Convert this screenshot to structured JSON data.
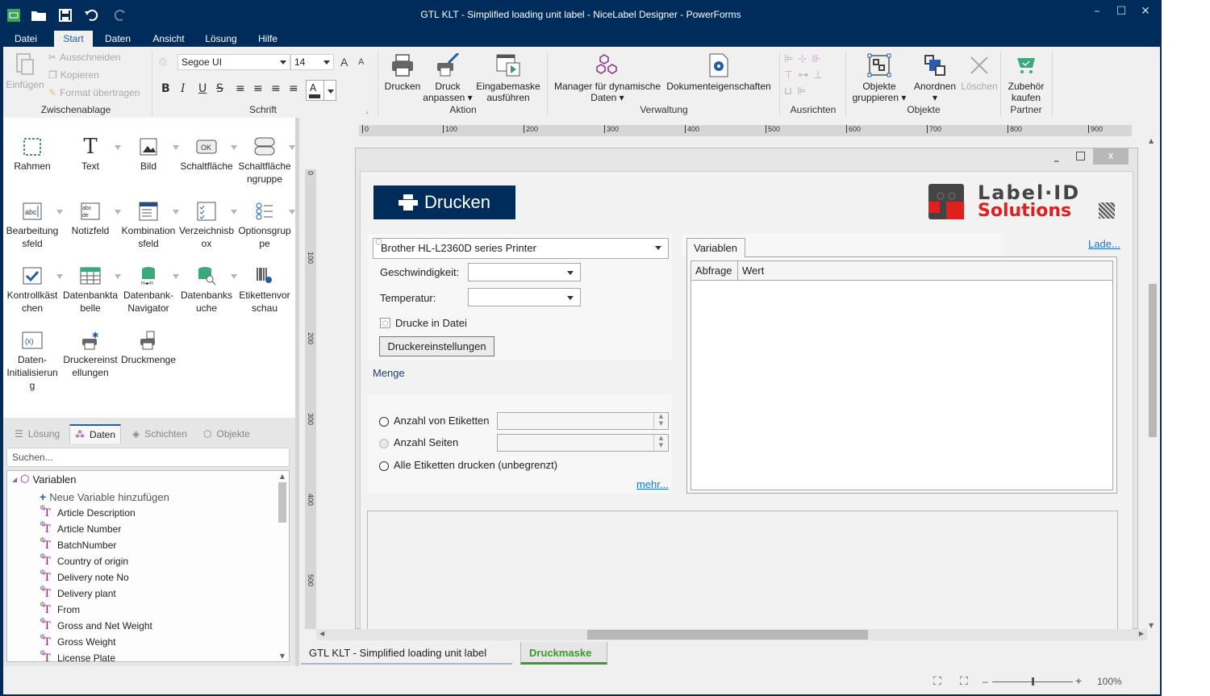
{
  "window": {
    "title": "GTL KLT - Simplified loading unit label - NiceLabel Designer - PowerForms",
    "controls": {
      "minimize": "–",
      "maximize": "☐",
      "close": "✕"
    }
  },
  "quick_access": [
    "app-icon",
    "open-folder-icon",
    "save-icon",
    "undo-icon",
    "redo-icon"
  ],
  "menu": {
    "items": [
      "Datei",
      "Start",
      "Daten",
      "Ansicht",
      "Lösung",
      "Hilfe"
    ],
    "active": "Start"
  },
  "ribbon": {
    "clipboard": {
      "label": "Zwischenablage",
      "paste": "Einfügen",
      "cut": "Ausschneiden",
      "copy": "Kopieren",
      "format_painter": "Format übertragen"
    },
    "font": {
      "label": "Schrift",
      "family": "Segoe UI",
      "size": "14",
      "bold": "B",
      "italic": "I",
      "underline": "U",
      "strike": "S",
      "color_letter": "A"
    },
    "action": {
      "label": "Aktion",
      "print": "Drucken",
      "customize_print_1": "Druck",
      "customize_print_2": "anpassen",
      "run_form_1": "Eingabemaske",
      "run_form_2": "ausführen"
    },
    "management": {
      "label": "Verwaltung",
      "dynamic_data_1": "Manager für dynamische",
      "dynamic_data_2": "Daten",
      "doc_props": "Dokumenteigenschaften"
    },
    "align": {
      "label": "Ausrichten"
    },
    "objects": {
      "label": "Objekte",
      "group_1": "Objekte",
      "group_2": "gruppieren",
      "arrange": "Anordnen",
      "delete": "Löschen"
    },
    "partner": {
      "label": "Partner",
      "buy_1": "Zubehör",
      "buy_2": "kaufen"
    }
  },
  "toolbox": {
    "items": [
      {
        "l1": "Rahmen",
        "l2": "",
        "l3": "",
        "icon": "frame-icon",
        "dd": false
      },
      {
        "l1": "Text",
        "l2": "",
        "l3": "",
        "icon": "text-icon",
        "dd": true
      },
      {
        "l1": "Bild",
        "l2": "",
        "l3": "",
        "icon": "image-icon",
        "dd": true
      },
      {
        "l1": "Schaltfläche",
        "l2": "",
        "l3": "",
        "icon": "button-icon",
        "dd": true
      },
      {
        "l1": "Schaltfläche",
        "l2": "ngruppe",
        "l3": "",
        "icon": "button-group-icon",
        "dd": true
      },
      {
        "l1": "Bearbeitung",
        "l2": "sfeld",
        "l3": "",
        "icon": "edit-field-icon",
        "dd": true
      },
      {
        "l1": "Notizfeld",
        "l2": "",
        "l3": "",
        "icon": "memo-field-icon",
        "dd": true
      },
      {
        "l1": "Kombination",
        "l2": "sfeld",
        "l3": "",
        "icon": "combo-box-icon",
        "dd": true
      },
      {
        "l1": "Verzeichnisb",
        "l2": "ox",
        "l3": "",
        "icon": "list-box-icon",
        "dd": true
      },
      {
        "l1": "Optionsgrup",
        "l2": "pe",
        "l3": "",
        "icon": "radio-group-icon",
        "dd": true
      },
      {
        "l1": "Kontrollkäst",
        "l2": "chen",
        "l3": "",
        "icon": "checkbox-icon",
        "dd": true
      },
      {
        "l1": "Datenbankta",
        "l2": "belle",
        "l3": "",
        "icon": "database-table-icon",
        "dd": true
      },
      {
        "l1": "Datenbank-",
        "l2": "Navigator",
        "l3": "",
        "icon": "database-navigator-icon",
        "dd": true
      },
      {
        "l1": "Datenbanks",
        "l2": "uche",
        "l3": "",
        "icon": "database-search-icon",
        "dd": true
      },
      {
        "l1": "Etikettenvor",
        "l2": "schau",
        "l3": "",
        "icon": "label-preview-icon",
        "dd": false
      },
      {
        "l1": "Daten-",
        "l2": "Initialisierun",
        "l3": "g",
        "icon": "data-init-icon",
        "dd": false
      },
      {
        "l1": "Druckereinst",
        "l2": "ellungen",
        "l3": "",
        "icon": "printer-settings-icon",
        "dd": false
      },
      {
        "l1": "Druckmenge",
        "l2": "",
        "l3": "",
        "icon": "print-quantity-icon",
        "dd": false
      }
    ]
  },
  "panel_tabs": {
    "items": [
      "Lösung",
      "Daten",
      "Schichten",
      "Objekte"
    ],
    "active": "Daten"
  },
  "data_panel": {
    "search_placeholder": "Suchen...",
    "root": "Variablen",
    "add_new": "Neue Variable hinzufügen",
    "variables": [
      "Article Description",
      "Article Number",
      "BatchNumber",
      "Country of origin",
      "Delivery note No",
      "Delivery plant",
      "From",
      "Gross and Net Weight",
      "Gross Weight",
      "License Plate"
    ]
  },
  "ruler": {
    "h_ticks": [
      "0",
      "100",
      "200",
      "300",
      "400",
      "500",
      "600",
      "700",
      "800",
      "900"
    ],
    "v_ticks": [
      "0",
      "100",
      "200",
      "300",
      "400",
      "500"
    ]
  },
  "form": {
    "window_controls": {
      "minimize": "_",
      "maximize": "□",
      "close": "x"
    },
    "print_button": "Drucken",
    "logo_line1": "Label·ID",
    "logo_line2": "Solutions",
    "printer": "Brother HL-L2360D series Printer",
    "speed_label": "Geschwindigkeit:",
    "speed_value": "",
    "temperature_label": "Temperatur:",
    "temperature_value": "",
    "print_to_file": "Drucke in Datei",
    "printer_settings": "Druckereinstellungen",
    "quantity_label": "Menge",
    "qty_labels": "Anzahl von Etiketten",
    "qty_pages": "Anzahl Seiten",
    "qty_all": "Alle Etiketten drucken (unbegrenzt)",
    "more": "mehr...",
    "load": "Lade...",
    "variables_tab": "Variablen",
    "grid_headers": [
      "Abfrage",
      "Wert"
    ]
  },
  "doc_tabs": {
    "items": [
      "GTL KLT - Simplified loading unit label",
      "Druckmaske"
    ],
    "active": "Druckmaske"
  },
  "status": {
    "zoom": "100%",
    "zoom_level_percent": 100
  },
  "colors": {
    "brand": "#002c5c",
    "accent_blue": "#1f5fa8",
    "active_tab_green": "#3a9a2e",
    "logo_red": "#e0201e",
    "link": "#1f73c8"
  }
}
